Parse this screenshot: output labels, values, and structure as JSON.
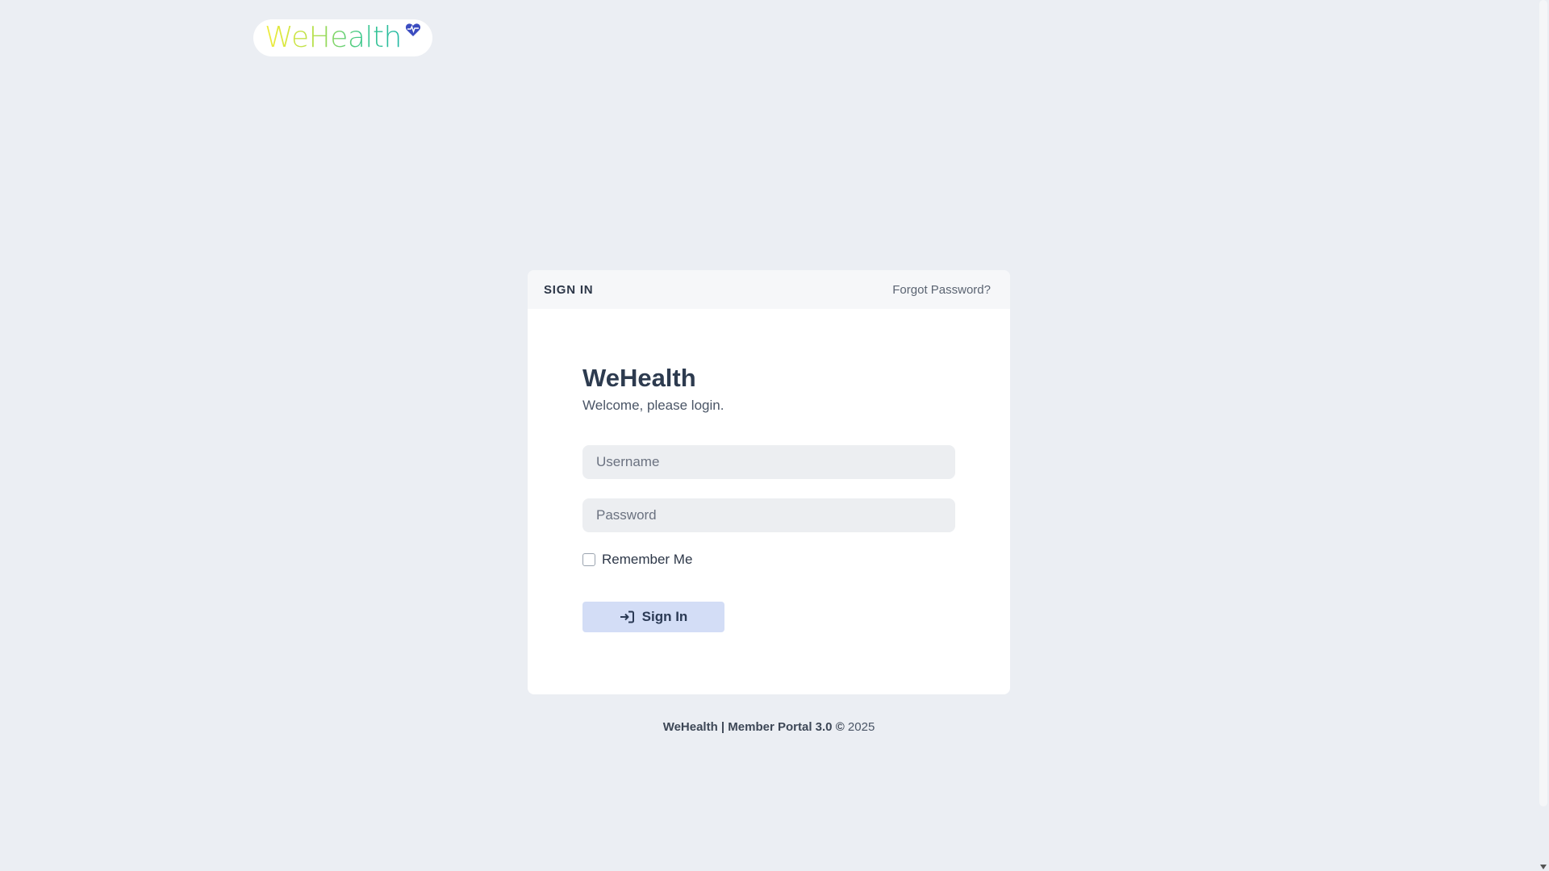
{
  "header": {
    "logo_text": "WeHealth",
    "logo_icon": "heart-pulse-icon"
  },
  "card": {
    "title": "SIGN IN",
    "forgot_link": "Forgot Password?",
    "brand": "WeHealth",
    "subtitle": "Welcome, please login.",
    "username": {
      "placeholder": "Username",
      "value": ""
    },
    "password": {
      "placeholder": "Password",
      "value": ""
    },
    "remember_label": "Remember Me",
    "remember_checked": false,
    "signin_label": "Sign In",
    "signin_icon": "sign-in-icon"
  },
  "footer": {
    "app": "WeHealth | Member Portal 3.0",
    "copyright_symbol": "©",
    "year": "2025"
  },
  "colors": {
    "background": "#ebeef3",
    "button": "#d3ddf6",
    "logo_gradient_start": "#f2ec3a",
    "logo_gradient_end": "#1fb7a5",
    "heart": "#3b4cc0"
  }
}
